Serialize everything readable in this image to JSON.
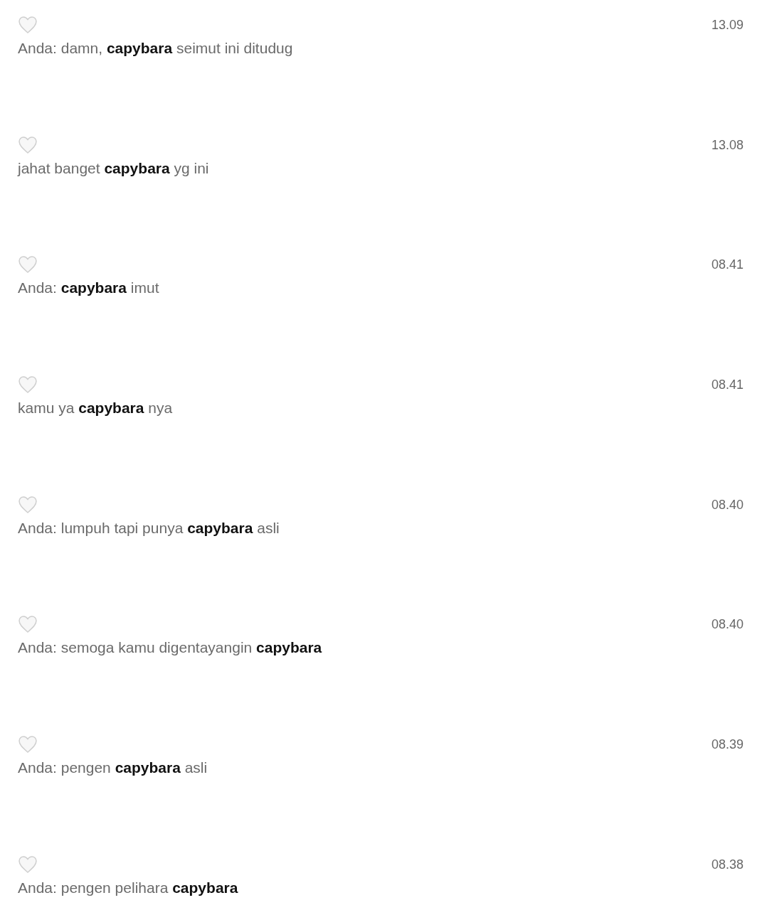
{
  "messages": [
    {
      "text": "Anda: damn, **capybara** seimut ini ditudug",
      "time": "13.09"
    },
    {
      "text": "jahat banget **capybara** yg ini",
      "time": "13.08"
    },
    {
      "text": "Anda: **capybara** imut",
      "time": "08.41"
    },
    {
      "text": "kamu ya **capybara** nya",
      "time": "08.41"
    },
    {
      "text": "Anda: lumpuh tapi punya **capybara** asli",
      "time": "08.40"
    },
    {
      "text": "Anda: semoga kamu digentayangin **capybara**",
      "time": "08.40"
    },
    {
      "text": "Anda: pengen **capybara** asli",
      "time": "08.39"
    },
    {
      "text": "Anda: pengen pelihara **capybara**",
      "time": "08.38"
    }
  ]
}
